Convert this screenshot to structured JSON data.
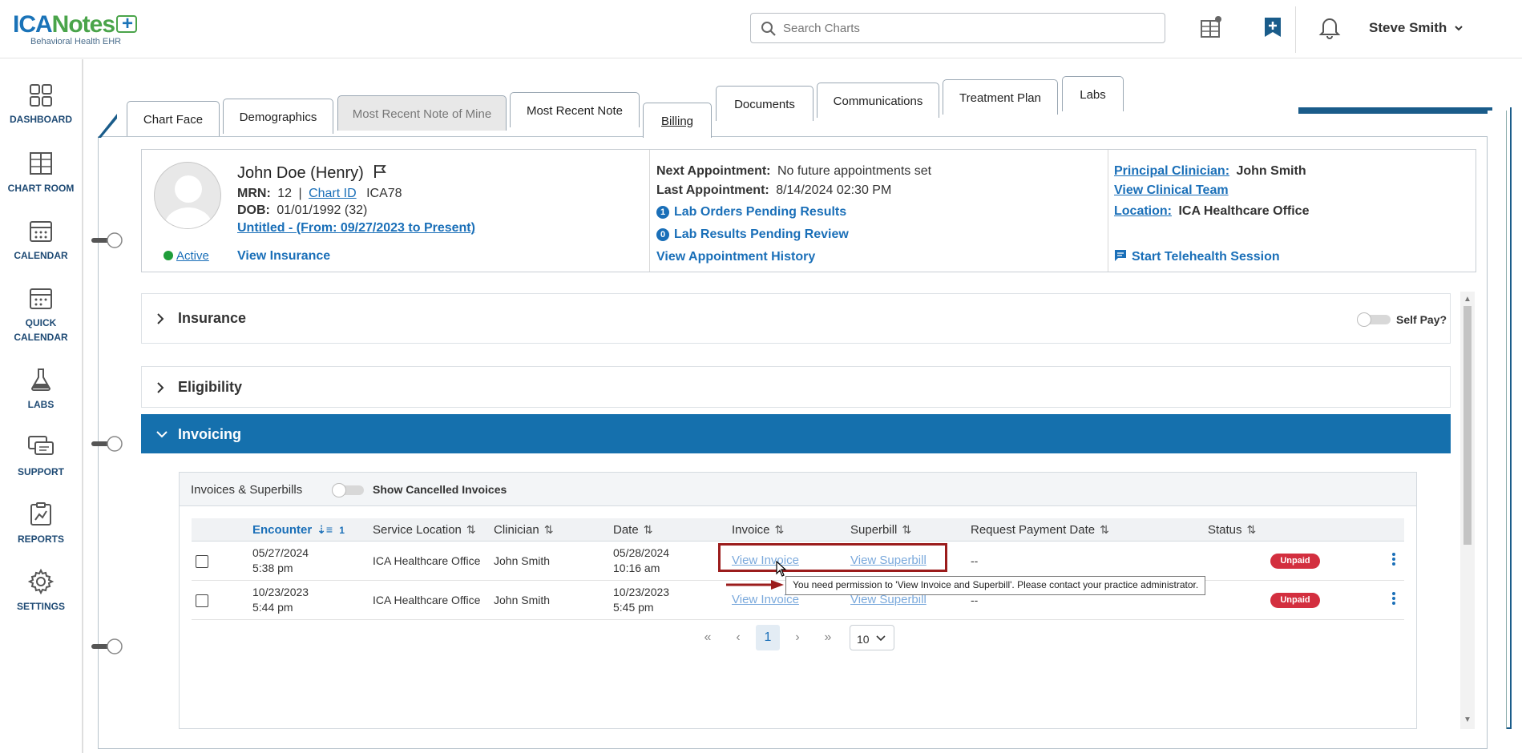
{
  "brand": {
    "logo_text_1": "ICA",
    "logo_text_2": "Notes",
    "logo_tagline": "Behavioral Health EHR"
  },
  "topbar": {
    "search_placeholder": "Search Charts",
    "user_name": "Steve Smith"
  },
  "leftnav": {
    "items": [
      {
        "label": "DASHBOARD",
        "icon": "dashboard-icon"
      },
      {
        "label": "CHART ROOM",
        "icon": "chart-room-icon"
      },
      {
        "label": "CALENDAR",
        "icon": "calendar-icon"
      },
      {
        "label": "QUICK CALENDAR",
        "line1": "QUICK",
        "line2": "CALENDAR",
        "icon": "quick-calendar-icon"
      },
      {
        "label": "LABS",
        "icon": "flask-icon"
      },
      {
        "label": "SUPPORT",
        "icon": "support-icon"
      },
      {
        "label": "REPORTS",
        "icon": "reports-icon"
      },
      {
        "label": "SETTINGS",
        "icon": "gear-icon"
      }
    ]
  },
  "tabs": [
    {
      "label": "Chart Face"
    },
    {
      "label": "Demographics"
    },
    {
      "label": "Most Recent Note of Mine",
      "disabled": true
    },
    {
      "label": "Most Recent Note"
    },
    {
      "label": "Billing",
      "active": true
    },
    {
      "label": "Documents"
    },
    {
      "label": "Communications"
    },
    {
      "label": "Treatment Plan"
    },
    {
      "label": "Labs"
    }
  ],
  "patient": {
    "name": "John Doe (Henry)",
    "mrn_label": "MRN:",
    "mrn_value": "12",
    "separator": "|",
    "chart_id_label": "Chart ID",
    "chart_id_value": "ICA78",
    "dob_label": "DOB:",
    "dob_value": "01/01/1992 (32)",
    "episode_link": "Untitled - (From: 09/27/2023 to Present)",
    "status": "Active",
    "view_insurance": "View Insurance",
    "next_appt_label": "Next Appointment:",
    "next_appt_value": "No future appointments set",
    "last_appt_label": "Last Appointment:",
    "last_appt_value": "8/14/2024 02:30 PM",
    "lab_orders_count": "1",
    "lab_orders_label": "Lab Orders Pending Results",
    "lab_results_count": "0",
    "lab_results_label": "Lab Results Pending Review",
    "view_appt_history": "View Appointment History",
    "principal_label": "Principal Clinician:",
    "principal_value": "John Smith",
    "view_team": "View Clinical Team",
    "location_label": "Location:",
    "location_value": "ICA Healthcare Office",
    "telehealth": "Start Telehealth Session"
  },
  "sections": {
    "insurance": "Insurance",
    "self_pay": "Self Pay?",
    "eligibility": "Eligibility",
    "invoicing": "Invoicing"
  },
  "invoices": {
    "title": "Invoices & Superbills",
    "show_cancelled": "Show Cancelled Invoices",
    "columns": {
      "encounter": "Encounter",
      "encounter_sort_index": "1",
      "service_location": "Service Location",
      "clinician": "Clinician",
      "date": "Date",
      "invoice": "Invoice",
      "superbill": "Superbill",
      "request_payment_date": "Request Payment Date",
      "status": "Status"
    },
    "rows": [
      {
        "encounter_date": "05/27/2024",
        "encounter_time": "5:38 pm",
        "service_location": "ICA Healthcare Office",
        "clinician": "John Smith",
        "date": "05/28/2024",
        "time": "10:16 am",
        "invoice": "View Invoice",
        "superbill": "View Superbill",
        "request_payment_date": "--",
        "status": "Unpaid"
      },
      {
        "encounter_date": "10/23/2023",
        "encounter_time": "5:44 pm",
        "service_location": "ICA Healthcare Office",
        "clinician": "John Smith",
        "date": "10/23/2023",
        "time": "5:45 pm",
        "invoice": "View Invoice",
        "superbill": "View Superbill",
        "request_payment_date": "--",
        "status": "Unpaid"
      }
    ],
    "tooltip": "You need permission to 'View Invoice and Superbill'. Please contact your practice administrator.",
    "pager": {
      "first": "«",
      "prev": "‹",
      "current_page": "1",
      "next": "›",
      "last": "»",
      "page_size": "10"
    }
  },
  "colors": {
    "brand_blue": "#1a6fb8",
    "invoicing_bar": "#1570ad",
    "unpaid": "#d32f3f",
    "highlight": "#9b1c1c"
  }
}
